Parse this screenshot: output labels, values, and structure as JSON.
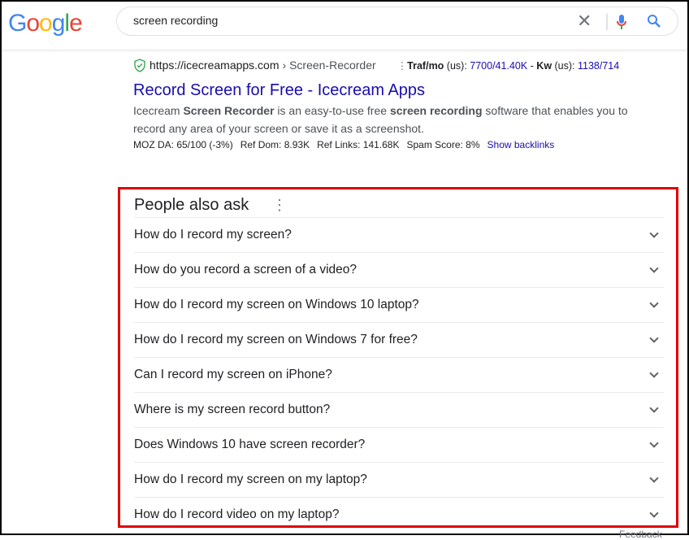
{
  "search": {
    "query": "screen recording"
  },
  "logo": {
    "letters": [
      "G",
      "o",
      "o",
      "g",
      "l",
      "e"
    ],
    "colors": [
      "#4285f4",
      "#ea4335",
      "#fbbc05",
      "#4285f4",
      "#34a853",
      "#ea4335"
    ]
  },
  "result": {
    "url": "https://icecreamapps.com",
    "breadcrumb": "› Screen-Recorder",
    "traf_label": "Traf/mo",
    "traf_us": " (us): ",
    "traf_value": "7700/41.40K",
    "sep": " - ",
    "kw_label": "Kw",
    "kw_us": " (us): ",
    "kw_value": "1138/714",
    "title": "Record Screen for Free - Icecream Apps",
    "snippet": [
      "Icecream ",
      "Screen Recorder",
      " is an easy-to-use free ",
      "screen recording",
      " software that enables you to record any area of your screen or save it as a screenshot."
    ],
    "metrics": [
      "MOZ DA: 65/100 (-3%)",
      "Ref Dom: 8.93K",
      "Ref Links: 141.68K",
      "Spam Score: 8%"
    ],
    "backlinks": "Show backlinks"
  },
  "paa": {
    "title": "People also ask",
    "questions": [
      "How do I record my screen?",
      "How do you record a screen of a video?",
      "How do I record my screen on Windows 10 laptop?",
      "How do I record my screen on Windows 7 for free?",
      "Can I record my screen on iPhone?",
      "Where is my screen record button?",
      "Does Windows 10 have screen recorder?",
      "How do I record my screen on my laptop?",
      "How do I record video on my laptop?"
    ]
  },
  "feedback": "Feedback",
  "colors": {
    "highlight": "#e00000",
    "link": "#1a0dab"
  }
}
